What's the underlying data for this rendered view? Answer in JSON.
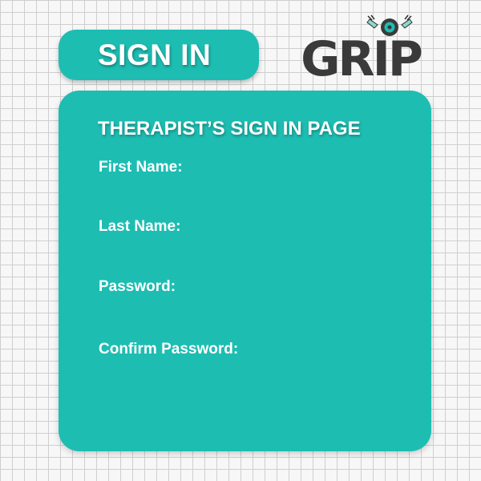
{
  "header": {
    "sign_in_label": "SIGN IN",
    "logo_text": "GRIP"
  },
  "form": {
    "title": "THERAPIST’S SIGN IN PAGE",
    "fields": [
      {
        "label": "First Name:",
        "value": ""
      },
      {
        "label": "Last Name:",
        "value": ""
      },
      {
        "label": "Password:",
        "value": ""
      },
      {
        "label": "Confirm Password:",
        "value": ""
      }
    ]
  },
  "colors": {
    "teal": "#1dbdb2",
    "logo_dark": "#3a3a3a",
    "grid_line": "#cfcfcf",
    "background": "#f7f7f7",
    "text": "#ffffff"
  }
}
